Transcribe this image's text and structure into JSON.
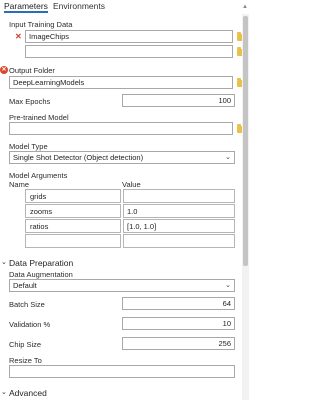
{
  "tabs": {
    "parameters": "Parameters",
    "environments": "Environments"
  },
  "input_training_data": {
    "label": "Input Training Data",
    "value": "ImageChips",
    "second_value": ""
  },
  "output_folder": {
    "label": "Output Folder",
    "value": "DeepLearningModels"
  },
  "max_epochs": {
    "label": "Max Epochs",
    "value": "100"
  },
  "pretrained_model": {
    "label": "Pre-trained Model",
    "value": ""
  },
  "model_type": {
    "label": "Model Type",
    "value": "Single Shot Detector (Object detection)"
  },
  "model_arguments": {
    "label": "Model Arguments",
    "col_name": "Name",
    "col_value": "Value",
    "rows": [
      {
        "name": "grids",
        "value": ""
      },
      {
        "name": "zooms",
        "value": "1.0"
      },
      {
        "name": "ratios",
        "value": "[1.0, 1.0]"
      },
      {
        "name": "",
        "value": ""
      }
    ]
  },
  "data_preparation": {
    "section": "Data Preparation",
    "augmentation_label": "Data Augmentation",
    "augmentation_value": "Default",
    "batch_size_label": "Batch Size",
    "batch_size_value": "64",
    "validation_label": "Validation %",
    "validation_value": "10",
    "chip_size_label": "Chip Size",
    "chip_size_value": "256",
    "resize_label": "Resize To",
    "resize_value": ""
  },
  "advanced": {
    "section": "Advanced"
  },
  "colors": {
    "accent": "#2a6ebb",
    "error": "#d9472b",
    "folder": "#e8c04a"
  }
}
